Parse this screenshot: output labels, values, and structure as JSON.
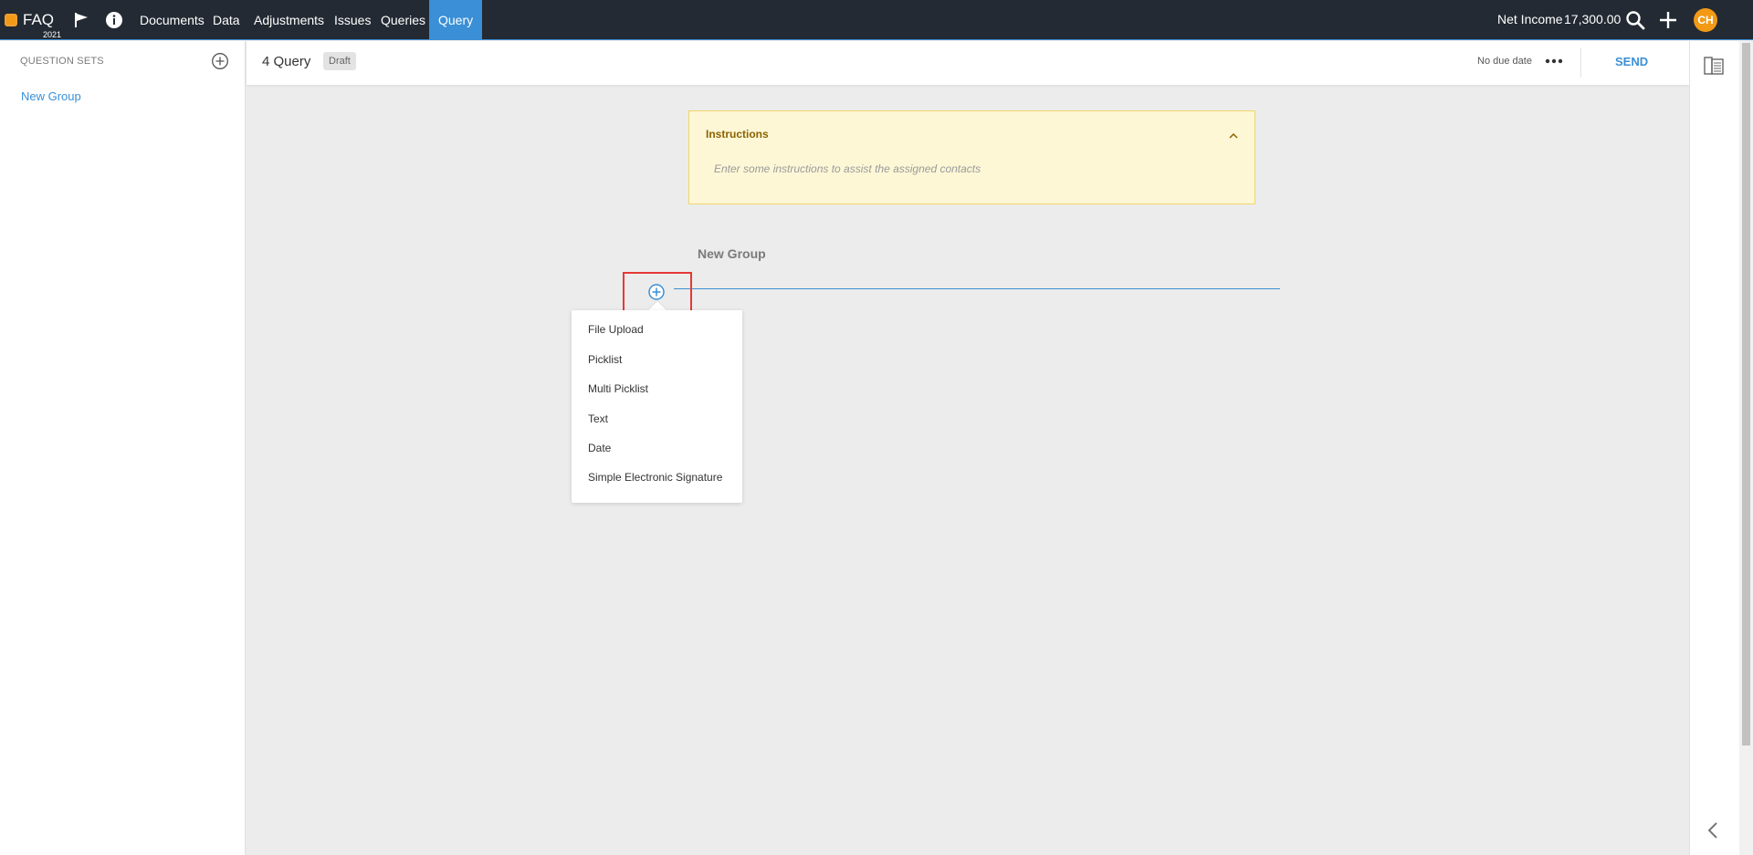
{
  "nav": {
    "brand": {
      "name": "FAQ",
      "year": "2021"
    },
    "items": [
      "Documents",
      "Data",
      "Adjustments",
      "Issues",
      "Queries",
      "Query"
    ],
    "net_income_label": "Net Income",
    "net_income_value": "17,300.00",
    "avatar_initials": "CH"
  },
  "sidebar": {
    "title": "QUESTION SETS",
    "items": [
      "New Group"
    ]
  },
  "header": {
    "title": "4 Query",
    "status": "Draft",
    "due": "No due date",
    "send": "SEND"
  },
  "instructions": {
    "title": "Instructions",
    "placeholder": "Enter some instructions to assist the assigned contacts"
  },
  "group": {
    "title": "New Group"
  },
  "menu": {
    "items": [
      "File Upload",
      "Picklist",
      "Multi Picklist",
      "Text",
      "Date",
      "Simple Electronic Signature"
    ]
  },
  "colors": {
    "accent": "#3a8fd6",
    "nav_bg": "#232a33",
    "brand": "#f29a16",
    "highlight": "#e53935"
  }
}
